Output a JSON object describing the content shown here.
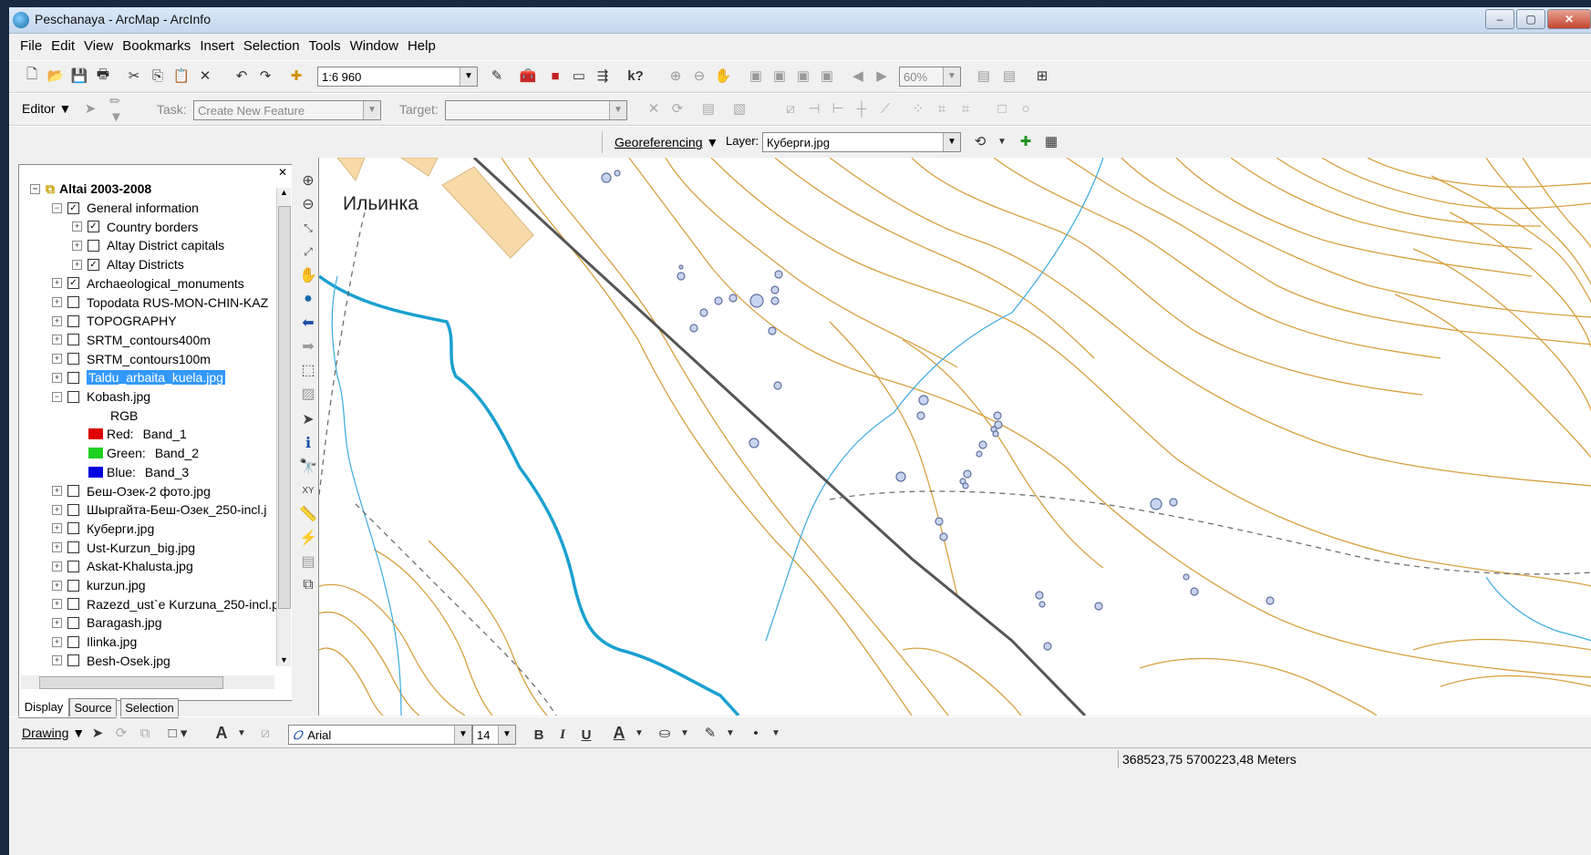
{
  "window": {
    "title": "Peschanaya - ArcMap - ArcInfo"
  },
  "menu": [
    "File",
    "Edit",
    "View",
    "Bookmarks",
    "Insert",
    "Selection",
    "Tools",
    "Window",
    "Help"
  ],
  "standard_toolbar": {
    "scale": "1:6 960",
    "zoom": "60%"
  },
  "editor_toolbar": {
    "editor_label": "Editor",
    "task_label": "Task:",
    "task_value": "Create New Feature",
    "target_label": "Target:"
  },
  "georef_toolbar": {
    "georef_label": "Georeferencing",
    "layer_label": "Layer:",
    "layer_value": "Куберги.jpg"
  },
  "toc": {
    "root": "Altai 2003-2008",
    "layers": [
      {
        "name": "General information",
        "checked": true,
        "expanded": true,
        "level": 1
      },
      {
        "name": "Country borders",
        "checked": true,
        "level": 2
      },
      {
        "name": "Altay District capitals",
        "checked": false,
        "level": 2
      },
      {
        "name": "Altay Districts",
        "checked": true,
        "level": 2
      },
      {
        "name": "Archaeological_monuments",
        "checked": true,
        "level": 1
      },
      {
        "name": "Topodata RUS-MON-CHIN-KAZ",
        "checked": false,
        "level": 1
      },
      {
        "name": "TOPOGRAPHY",
        "checked": false,
        "level": 1
      },
      {
        "name": "SRTM_contours400m",
        "checked": false,
        "level": 1
      },
      {
        "name": "SRTM_contours100m",
        "checked": false,
        "level": 1
      },
      {
        "name": "Taldu_arbaita_kuela.jpg",
        "checked": false,
        "level": 1,
        "selected": true
      },
      {
        "name": "Kobash.jpg",
        "checked": false,
        "expanded": true,
        "level": 1
      },
      {
        "name": "RGB",
        "legend": true
      },
      {
        "name": "Red:",
        "band": "Band_1",
        "color": "#e00000",
        "legend": true
      },
      {
        "name": "Green:",
        "band": "Band_2",
        "color": "#20d020",
        "legend": true
      },
      {
        "name": "Blue:",
        "band": "Band_3",
        "color": "#0000e0",
        "legend": true
      },
      {
        "name": "Беш-Озек-2 фото.jpg",
        "checked": false,
        "level": 1
      },
      {
        "name": "Шыргайта-Беш-Озек_250-incl.j",
        "checked": false,
        "level": 1
      },
      {
        "name": "Куберги.jpg",
        "checked": false,
        "level": 1
      },
      {
        "name": "Ust-Kurzun_big.jpg",
        "checked": false,
        "level": 1
      },
      {
        "name": "Askat-Khalusta.jpg",
        "checked": false,
        "level": 1
      },
      {
        "name": "kurzun.jpg",
        "checked": false,
        "level": 1
      },
      {
        "name": "Razezd_ust`e Kurzuna_250-incl.p",
        "checked": false,
        "level": 1
      },
      {
        "name": "Baragash.jpg",
        "checked": false,
        "level": 1
      },
      {
        "name": "Ilinka.jpg",
        "checked": false,
        "level": 1
      },
      {
        "name": "Besh-Osek.jpg",
        "checked": false,
        "level": 1
      }
    ],
    "tabs": [
      "Display",
      "Source",
      "Selection"
    ]
  },
  "map": {
    "place_label": "Ильинка"
  },
  "drawing_toolbar": {
    "drawing_label": "Drawing",
    "font": "Arial",
    "size": "14",
    "bold": "B",
    "italic": "I",
    "underline": "U"
  },
  "status": {
    "coords": "368523,75  5700223,48 Meters"
  }
}
